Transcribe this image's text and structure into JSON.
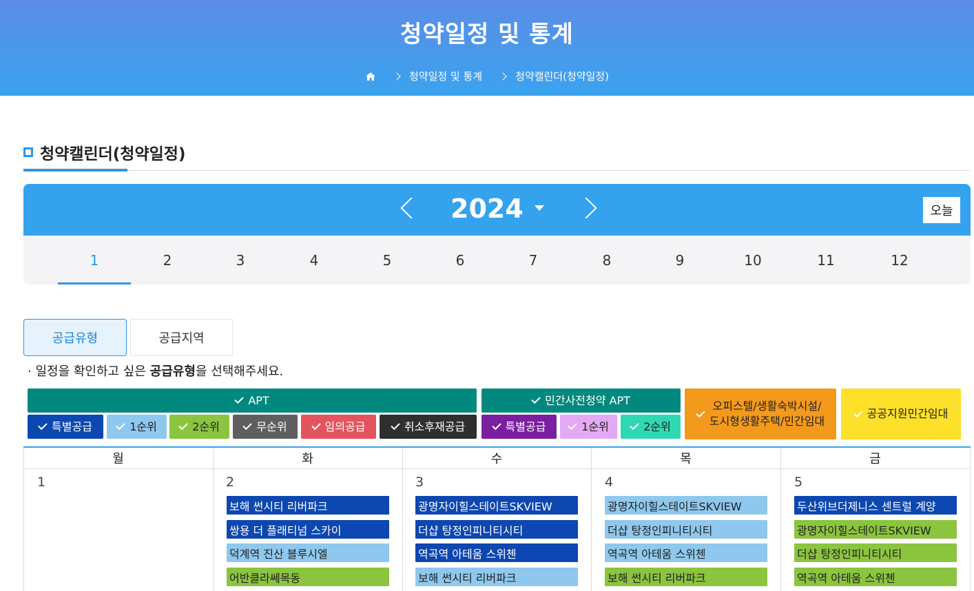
{
  "header": {
    "title": "청약일정 및 통계",
    "breadcrumb": [
      "청약일정 및 통계",
      "청약캘린더(청약일정)"
    ]
  },
  "section": {
    "title": "청약캘린더(청약일정)"
  },
  "year_nav": {
    "year": "2024",
    "today_label": "오늘"
  },
  "months": [
    "1",
    "2",
    "3",
    "4",
    "5",
    "6",
    "7",
    "8",
    "9",
    "10",
    "11",
    "12"
  ],
  "active_month": "1",
  "tabs": {
    "supply_type": "공급유형",
    "supply_region": "공급지역"
  },
  "hint": {
    "prefix": "· 일정을 확인하고 싶은 ",
    "bold": "공급유형",
    "suffix": "을 선택해주세요."
  },
  "filters": {
    "apt_group": "APT",
    "private_group": "민간사전청약 APT",
    "officetel_line1": "오피스텔/생활숙박시설/",
    "officetel_line2": "도시형생활주택/민간임대",
    "public_rental": "공공지원민간임대",
    "apt_items": [
      "특별공급",
      "1순위",
      "2순위",
      "무순위",
      "임의공급",
      "취소후재공급"
    ],
    "private_items": [
      "특별공급",
      "1순위",
      "2순위"
    ]
  },
  "colors": {
    "special": "#0d47b1",
    "rank1": "#8ec8ee",
    "rank2": "#8bc43f",
    "norank": "#5f5f5f",
    "optional": "#e4545f",
    "resupply": "#2f2f2f",
    "private_special": "#7a1fa0",
    "private_rank1": "#e3a9f3",
    "private_rank2": "#2ed8b2",
    "apt_header": "#02897f",
    "officetel": "#f39a1c",
    "public_rental": "#fde02a"
  },
  "calendar": {
    "weekdays": [
      "월",
      "화",
      "수",
      "목",
      "금"
    ],
    "days": [
      {
        "day": "1",
        "events": []
      },
      {
        "day": "2",
        "events": [
          {
            "name": "보해 썬시티 리버파크",
            "type": "special"
          },
          {
            "name": "쌍용 더 플래티넘 스카이",
            "type": "special"
          },
          {
            "name": "덕계역 진산 블루시엘",
            "type": "rank1"
          },
          {
            "name": "어반클라쎄목동",
            "type": "rank2"
          }
        ]
      },
      {
        "day": "3",
        "events": [
          {
            "name": "광명자이힐스테이트SKVIEW",
            "type": "special"
          },
          {
            "name": "더샵 탕정인피니티시티",
            "type": "special"
          },
          {
            "name": "역곡역 아테움 스위첸",
            "type": "special"
          },
          {
            "name": "보해 썬시티 리버파크",
            "type": "rank1"
          }
        ]
      },
      {
        "day": "4",
        "events": [
          {
            "name": "광명자이힐스테이트SKVIEW",
            "type": "rank1"
          },
          {
            "name": "더샵 탕정인피니티시티",
            "type": "rank1"
          },
          {
            "name": "역곡역 아테움 스위첸",
            "type": "rank1"
          },
          {
            "name": "보해 썬시티 리버파크",
            "type": "rank2"
          }
        ]
      },
      {
        "day": "5",
        "events": [
          {
            "name": "두산위브더제니스 센트럴 계양",
            "type": "special"
          },
          {
            "name": "광명자이힐스테이트SKVIEW",
            "type": "rank2"
          },
          {
            "name": "더샵 탕정인피니티시티",
            "type": "rank2"
          },
          {
            "name": "역곡역 아테움 스위첸",
            "type": "rank2"
          }
        ]
      }
    ]
  }
}
